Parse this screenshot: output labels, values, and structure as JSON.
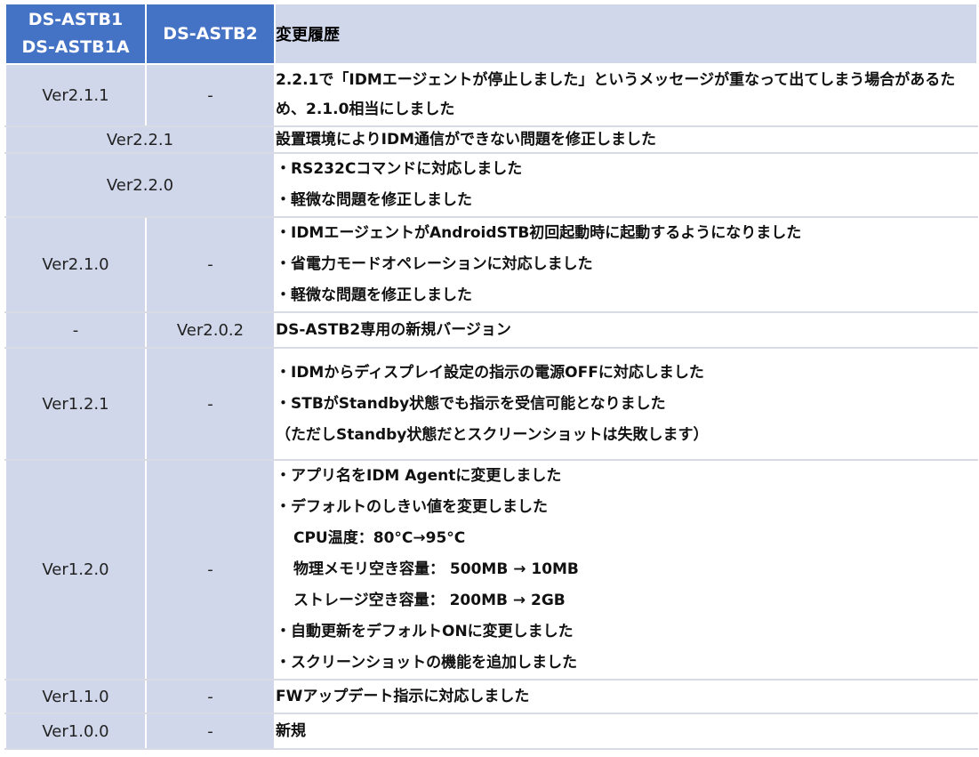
{
  "header": {
    "col1": [
      "DS-ASTB1",
      "DS-ASTB1A"
    ],
    "col2": "DS-ASTB2",
    "col3": "変更履歴"
  },
  "rows": [
    {
      "astb1": "Ver2.1.1",
      "astb2": "-",
      "lines": [
        "2.2.1で「IDMエージェントが停止しました」というメッセージが重なって出てしまう場合があるため、2.1.0相当にしました"
      ]
    },
    {
      "merged": "Ver2.2.1",
      "lines": [
        "設置環境によりIDM通信ができない問題を修正しました"
      ]
    },
    {
      "merged": "Ver2.2.0",
      "lines": [
        "・RS232Cコマンドに対応しました",
        "・軽微な問題を修正しました"
      ]
    },
    {
      "astb1": "Ver2.1.0",
      "astb2": "-",
      "lines": [
        "・IDMエージェントがAndroidSTB初回起動時に起動するようになりました",
        "・省電力モードオペレーションに対応しました",
        "・軽微な問題を修正しました"
      ]
    },
    {
      "astb1": "-",
      "astb2": "Ver2.0.2",
      "lines": [
        "DS-ASTB2専用の新規バージョン"
      ]
    },
    {
      "astb1": "Ver1.2.1",
      "astb2": "-",
      "lines": [
        "・IDMからディスプレイ設定の指示の電源OFFに対応しました",
        "・STBがStandby状態でも指示を受信可能となりました",
        "（ただしStandby状態だとスクリーンショットは失敗します）"
      ]
    },
    {
      "astb1": "Ver1.2.0",
      "astb2": "-",
      "lines": [
        "・アプリ名をIDM Agentに変更しました",
        "・デフォルトのしきい値を変更しました",
        "CPU温度：80°C→95°C",
        "物理メモリ空き容量： 500MB → 10MB",
        "ストレージ空き容量： 200MB → 2GB",
        "・自動更新をデフォルトONに変更しました",
        "・スクリーンショットの機能を追加しました"
      ]
    },
    {
      "astb1": "Ver1.1.0",
      "astb2": "-",
      "lines": [
        "FWアップデート指示に対応しました"
      ]
    },
    {
      "astb1": "Ver1.0.0",
      "astb2": "-",
      "lines": [
        "新規"
      ]
    }
  ]
}
